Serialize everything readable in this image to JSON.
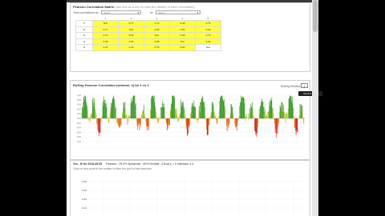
{
  "matrix_panel": {
    "title": "Pearson Correlation Matrix",
    "subtitle": "(use this as a key to view the details of each correlation)",
    "label_left": "Yield correlations for",
    "select_left": "Select",
    "label_vs": "vs",
    "select_right": "Select",
    "col_headers": [
      "1",
      "2",
      "3",
      "4",
      "5"
    ],
    "rows": [
      {
        "label": "1",
        "cells": [
          "N/A",
          "0.77",
          "0.72",
          "0.38",
          "0.75"
        ]
      },
      {
        "label": "2",
        "cells": [
          "0.77",
          "N/A",
          "0.55",
          "0.52",
          "0.42"
        ]
      },
      {
        "label": "3",
        "cells": [
          "0.72",
          "0.55",
          "N/A",
          "0.68",
          "0.75"
        ]
      },
      {
        "label": "4",
        "cells": [
          "0.38",
          "0.52",
          "0.68",
          "N/A",
          "0.62"
        ]
      },
      {
        "label": "5",
        "cells": [
          "0.47",
          "0.42",
          "0.75",
          "0.62",
          "N/A"
        ]
      }
    ]
  },
  "rolling_panel": {
    "title": "Rolling Pearson Correlation (window: 4) for 1 vs 2",
    "window_label": "Rolling Window:",
    "window_value": "4",
    "tooltip": "Scroll to zoom",
    "y_ticks": [
      "1.0",
      "0.8",
      "0.6",
      "0.4",
      "0.2",
      "0.0",
      "-0.2",
      "-0.4",
      "-0.6",
      "-0.8",
      "-1.0"
    ]
  },
  "scatter_panel": {
    "title": "Yes - B for 2018-05-05",
    "stats": "Pearson: -25.3%   Spearman: -40%   Kendall: -4   Eval p = 0   Intercept: 4.4",
    "hint": "Click on any point in the scatter to filter the grid to that date/pair",
    "y_ticks": [
      "0.80",
      "0.60",
      "0.40",
      "0.20",
      "0.00"
    ]
  },
  "chart_data": {
    "type": "line",
    "title": "Rolling Pearson Correlation (window: 4) for 1 vs 2",
    "ylim": [
      -1,
      1
    ],
    "grid": true,
    "note": "dense oscillating series, color graded by value (green high, red low)"
  }
}
